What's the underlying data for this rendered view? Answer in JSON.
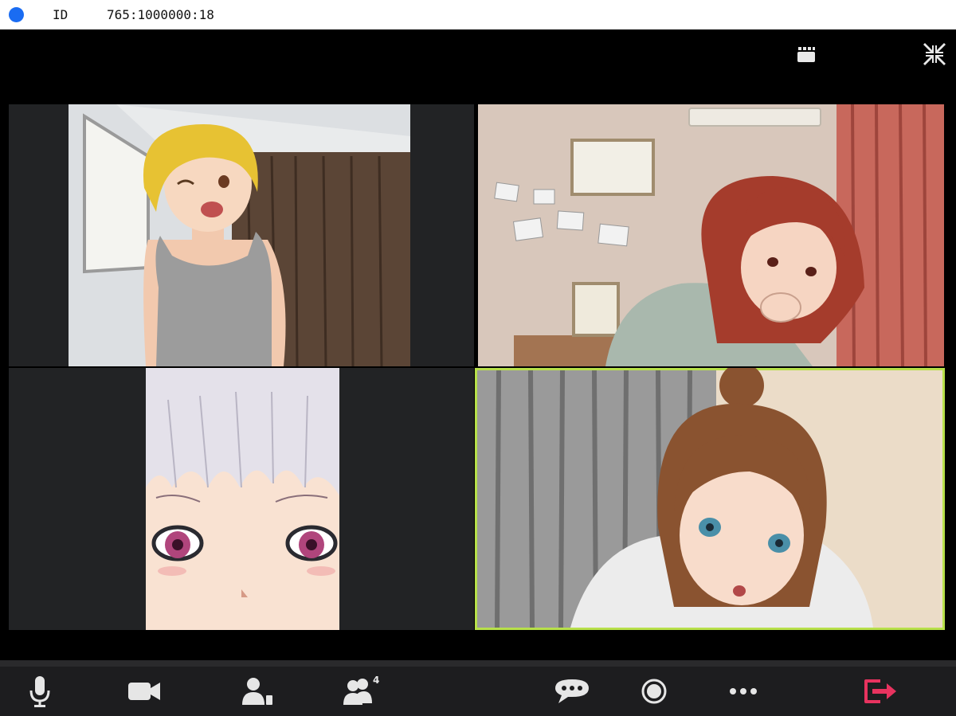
{
  "topbar": {
    "id_label": "ID",
    "meeting_id": "765:1000000:18",
    "record_color": "#1a6cf2"
  },
  "controls": {
    "view_icon": "gallery-view-icon",
    "fullscreen_icon": "exit-fullscreen-icon"
  },
  "participants": [
    {
      "name": "",
      "description_icon": "video-tile",
      "active": false
    },
    {
      "name": "",
      "description_icon": "video-tile",
      "active": false
    },
    {
      "name": "",
      "description_icon": "video-tile",
      "active": false
    },
    {
      "name": "",
      "description_icon": "video-tile",
      "active": true
    }
  ],
  "toolbar": {
    "items": [
      {
        "icon": "microphone-icon"
      },
      {
        "icon": "video-camera-icon"
      },
      {
        "icon": "participant-icon"
      },
      {
        "icon": "participants-group-icon",
        "badge": "4"
      },
      {
        "icon": "chat-icon"
      },
      {
        "icon": "record-icon"
      },
      {
        "icon": "more-icon"
      },
      {
        "icon": "leave-icon"
      }
    ],
    "participant_count": "4",
    "accent_active": "#b7e04a",
    "leave_color": "#e8335f"
  }
}
